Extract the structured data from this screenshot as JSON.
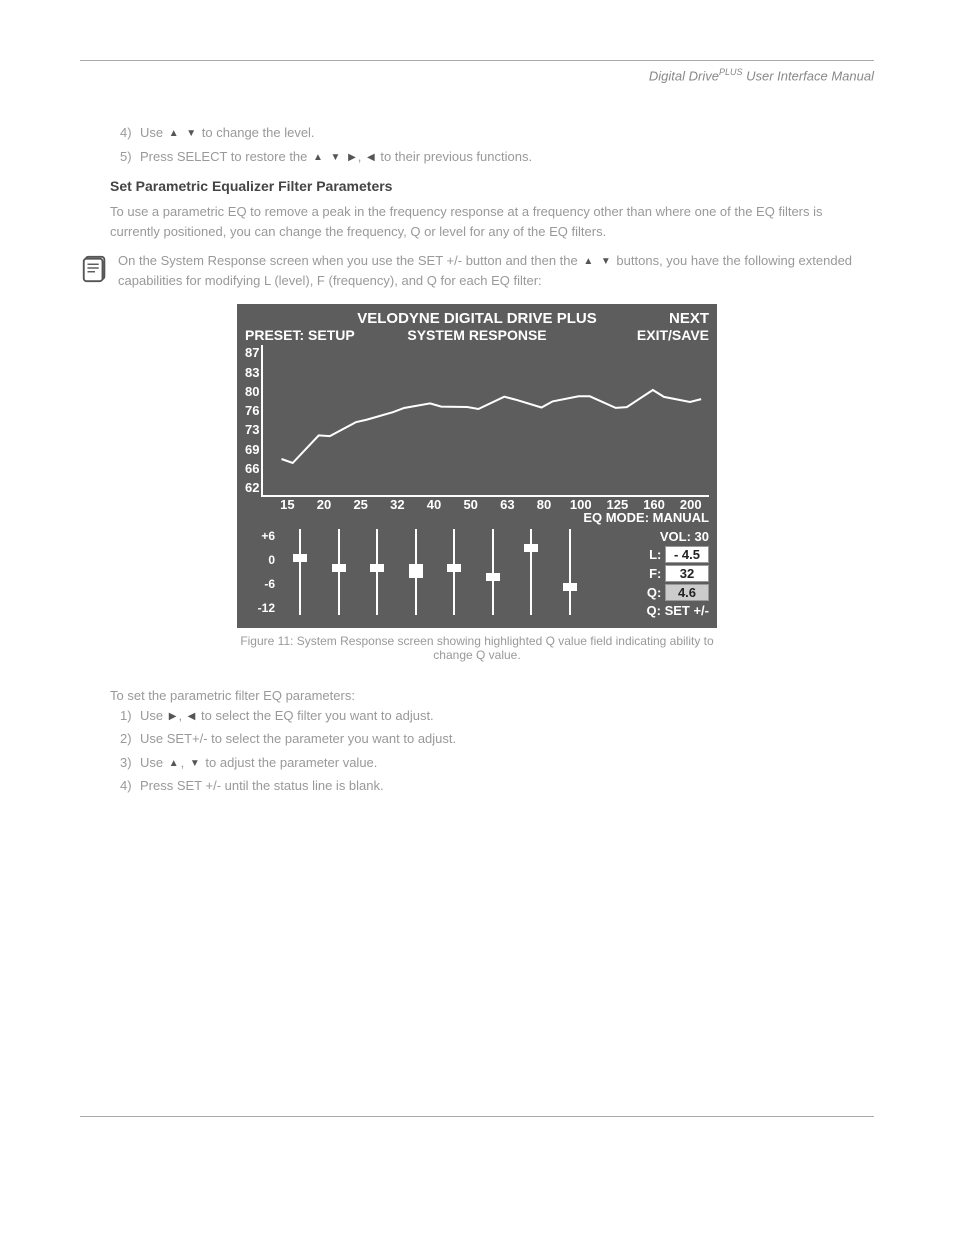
{
  "header": {
    "product": "Digital Drive",
    "sup": "PLUS",
    "tail": " User Interface Manual"
  },
  "top_bullets": [
    {
      "num": "4)",
      "pre": "Use ",
      "glyphs": "▲ ▼",
      "post": " to change the level."
    },
    {
      "num": "",
      "pre": "",
      "glyphs": "▲ ▼ ▶ ◀",
      "post": ""
    },
    {
      "num": "5)",
      "pre": "Press SELECT to restore the ",
      "glyphs": "",
      "post": "to their previous functions."
    }
  ],
  "section_heading": "Set Parametric Equalizer Filter Parameters",
  "intro_line1": "To use a parametric EQ to remove a peak in the frequency response at a frequency other than where one of",
  "intro_line2": "the EQ filters is currently positioned, you can change the frequency, Q or level for any of the EQ filters.",
  "note": {
    "pre": "On the System Response screen when you use the SET +/- button and then the ",
    "glyphs": "▲ ▼",
    "post": " buttons, you have the following extended capabilities for modifying L (level), F (frequency), and Q for each EQ filter:"
  },
  "figure": {
    "title_center": "VELODYNE DIGITAL DRIVE PLUS",
    "title_right": "NEXT",
    "sub_left": "PRESET: SETUP",
    "sub_center": "SYSTEM RESPONSE",
    "sub_right": "EXIT/SAVE",
    "eq_mode": "EQ MODE: MANUAL",
    "vol_label": "VOL:",
    "vol_value": "30",
    "L_label": "L:",
    "L_value": "- 4.5",
    "F_label": "F:",
    "F_value": "32",
    "Q_label": "Q:",
    "Q_value": "4.6",
    "q_set": "Q: SET +/-",
    "caption": "Figure 11: System Response screen showing highlighted Q value field indicating ability to change Q value."
  },
  "chart_data": {
    "type": "line",
    "title": "SYSTEM RESPONSE",
    "xlabel": "",
    "ylabel": "",
    "ylim": [
      62,
      87
    ],
    "y_ticks": [
      "87",
      "83",
      "80",
      "76",
      "73",
      "69",
      "66",
      "62"
    ],
    "x_ticks": [
      "15",
      "20",
      "25",
      "32",
      "40",
      "50",
      "63",
      "80",
      "100",
      "125",
      "160",
      "200"
    ],
    "categories": [
      15,
      20,
      25,
      32,
      40,
      50,
      63,
      80,
      100,
      125,
      160,
      200
    ],
    "values": [
      68,
      72,
      74,
      76,
      77,
      77,
      78,
      77,
      78,
      77,
      79,
      78
    ],
    "eq_sliders": {
      "y_ticks": [
        "+6",
        "0",
        "-6",
        "-12"
      ],
      "range": [
        -12,
        6
      ],
      "positions": [
        {
          "freq": 15,
          "level": 0
        },
        {
          "freq": 20,
          "level": -2
        },
        {
          "freq": 25,
          "level": -2
        },
        {
          "freq": 32,
          "level": -2
        },
        {
          "freq": 40,
          "level": -2
        },
        {
          "freq": 50,
          "level": -4
        },
        {
          "freq": 63,
          "level": 2
        },
        {
          "freq": 80,
          "level": -6
        }
      ]
    }
  },
  "lower_intro": "To set the parametric filter EQ parameters:",
  "lower_bullets": [
    {
      "num": "1)",
      "pre": "Use ",
      "glyphs": "▶ ◀",
      "post": " to select the EQ filter you want to adjust."
    },
    {
      "num": "2)",
      "pre": "Use SET+/- to select the parameter you want to adjust.",
      "glyphs": "",
      "post": ""
    },
    {
      "num": "3)",
      "pre": "Use ",
      "glyphs": "▲ ▼",
      "post": " to adjust the parameter value."
    },
    {
      "num": "4)",
      "pre": "Press SET +/- until the status line is blank.",
      "glyphs": "",
      "post": ""
    }
  ]
}
